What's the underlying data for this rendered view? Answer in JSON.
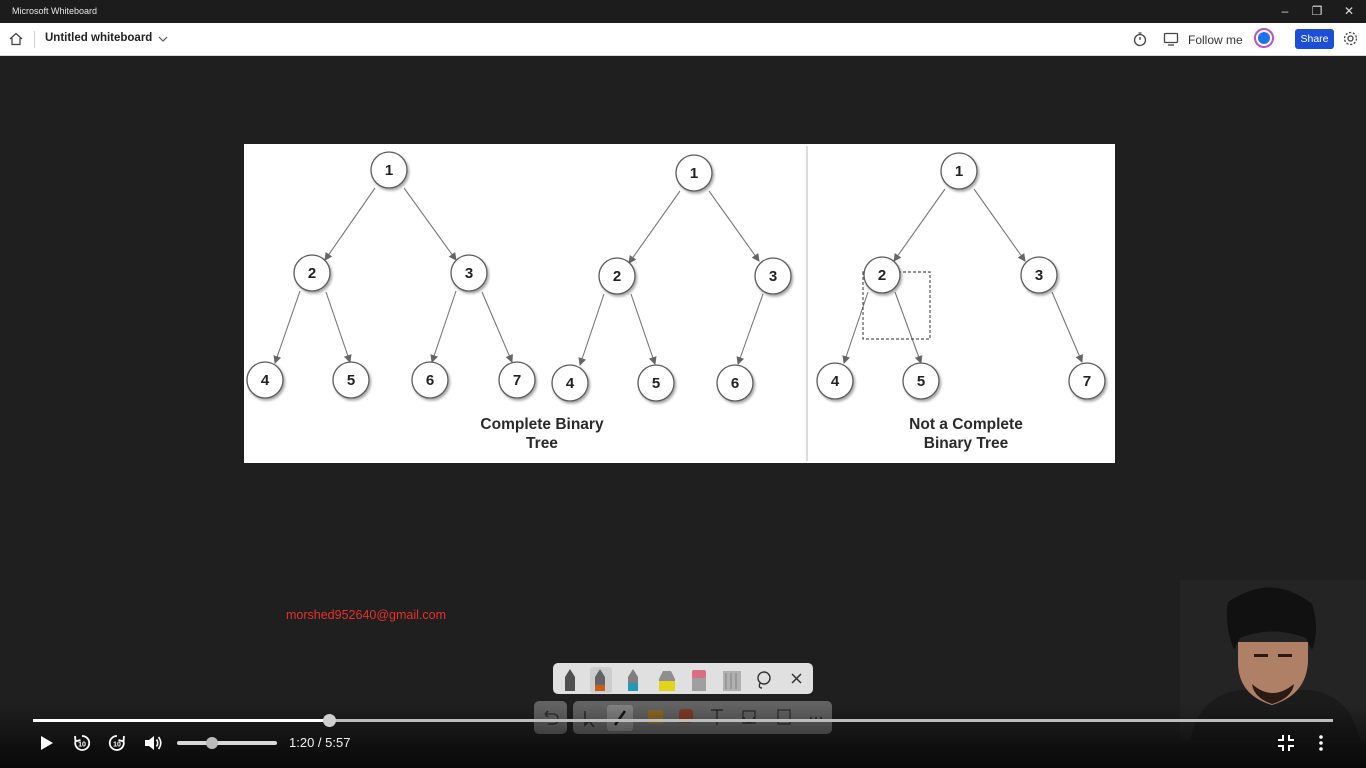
{
  "window": {
    "app_title": "Microsoft Whiteboard",
    "minimize_glyph": "–",
    "restore_glyph": "❐",
    "close_glyph": "✕"
  },
  "toolbar": {
    "board_title": "Untitled whiteboard",
    "follow_label": "Follow me",
    "share_label": "Share",
    "icons": [
      "home-icon",
      "chevron-down-icon",
      "timer-icon",
      "screen-share-icon",
      "avatar",
      "gear-icon"
    ],
    "share_color": "#1c4fd8"
  },
  "diagram": {
    "left_caption_line1": "Complete Binary",
    "left_caption_line2": "Tree",
    "right_caption_line1": "Not a Complete",
    "right_caption_line2": "Binary Tree",
    "tree1_nodes": [
      "1",
      "2",
      "3",
      "4",
      "5",
      "6",
      "7"
    ],
    "tree2_nodes": [
      "1",
      "2",
      "3",
      "4",
      "5",
      "6"
    ],
    "tree3_nodes": [
      "1",
      "2",
      "3",
      "4",
      "5",
      "7"
    ]
  },
  "overlay": {
    "email": "morshed952640@gmail.com",
    "email_color": "#e8302c"
  },
  "pen_tray": {
    "tools": [
      "pen-black",
      "pen-orange",
      "pen-teal",
      "highlighter-yellow",
      "eraser-pink",
      "ruler",
      "lasso-icon",
      "close-icon"
    ]
  },
  "video": {
    "time_display": "1:20 / 5:57",
    "progress_fraction": 0.228,
    "volume_fraction": 0.35,
    "controls": [
      "play-icon",
      "rewind-10-icon",
      "forward-10-icon",
      "volume-icon",
      "exit-fullscreen-icon",
      "more-options-icon"
    ]
  }
}
